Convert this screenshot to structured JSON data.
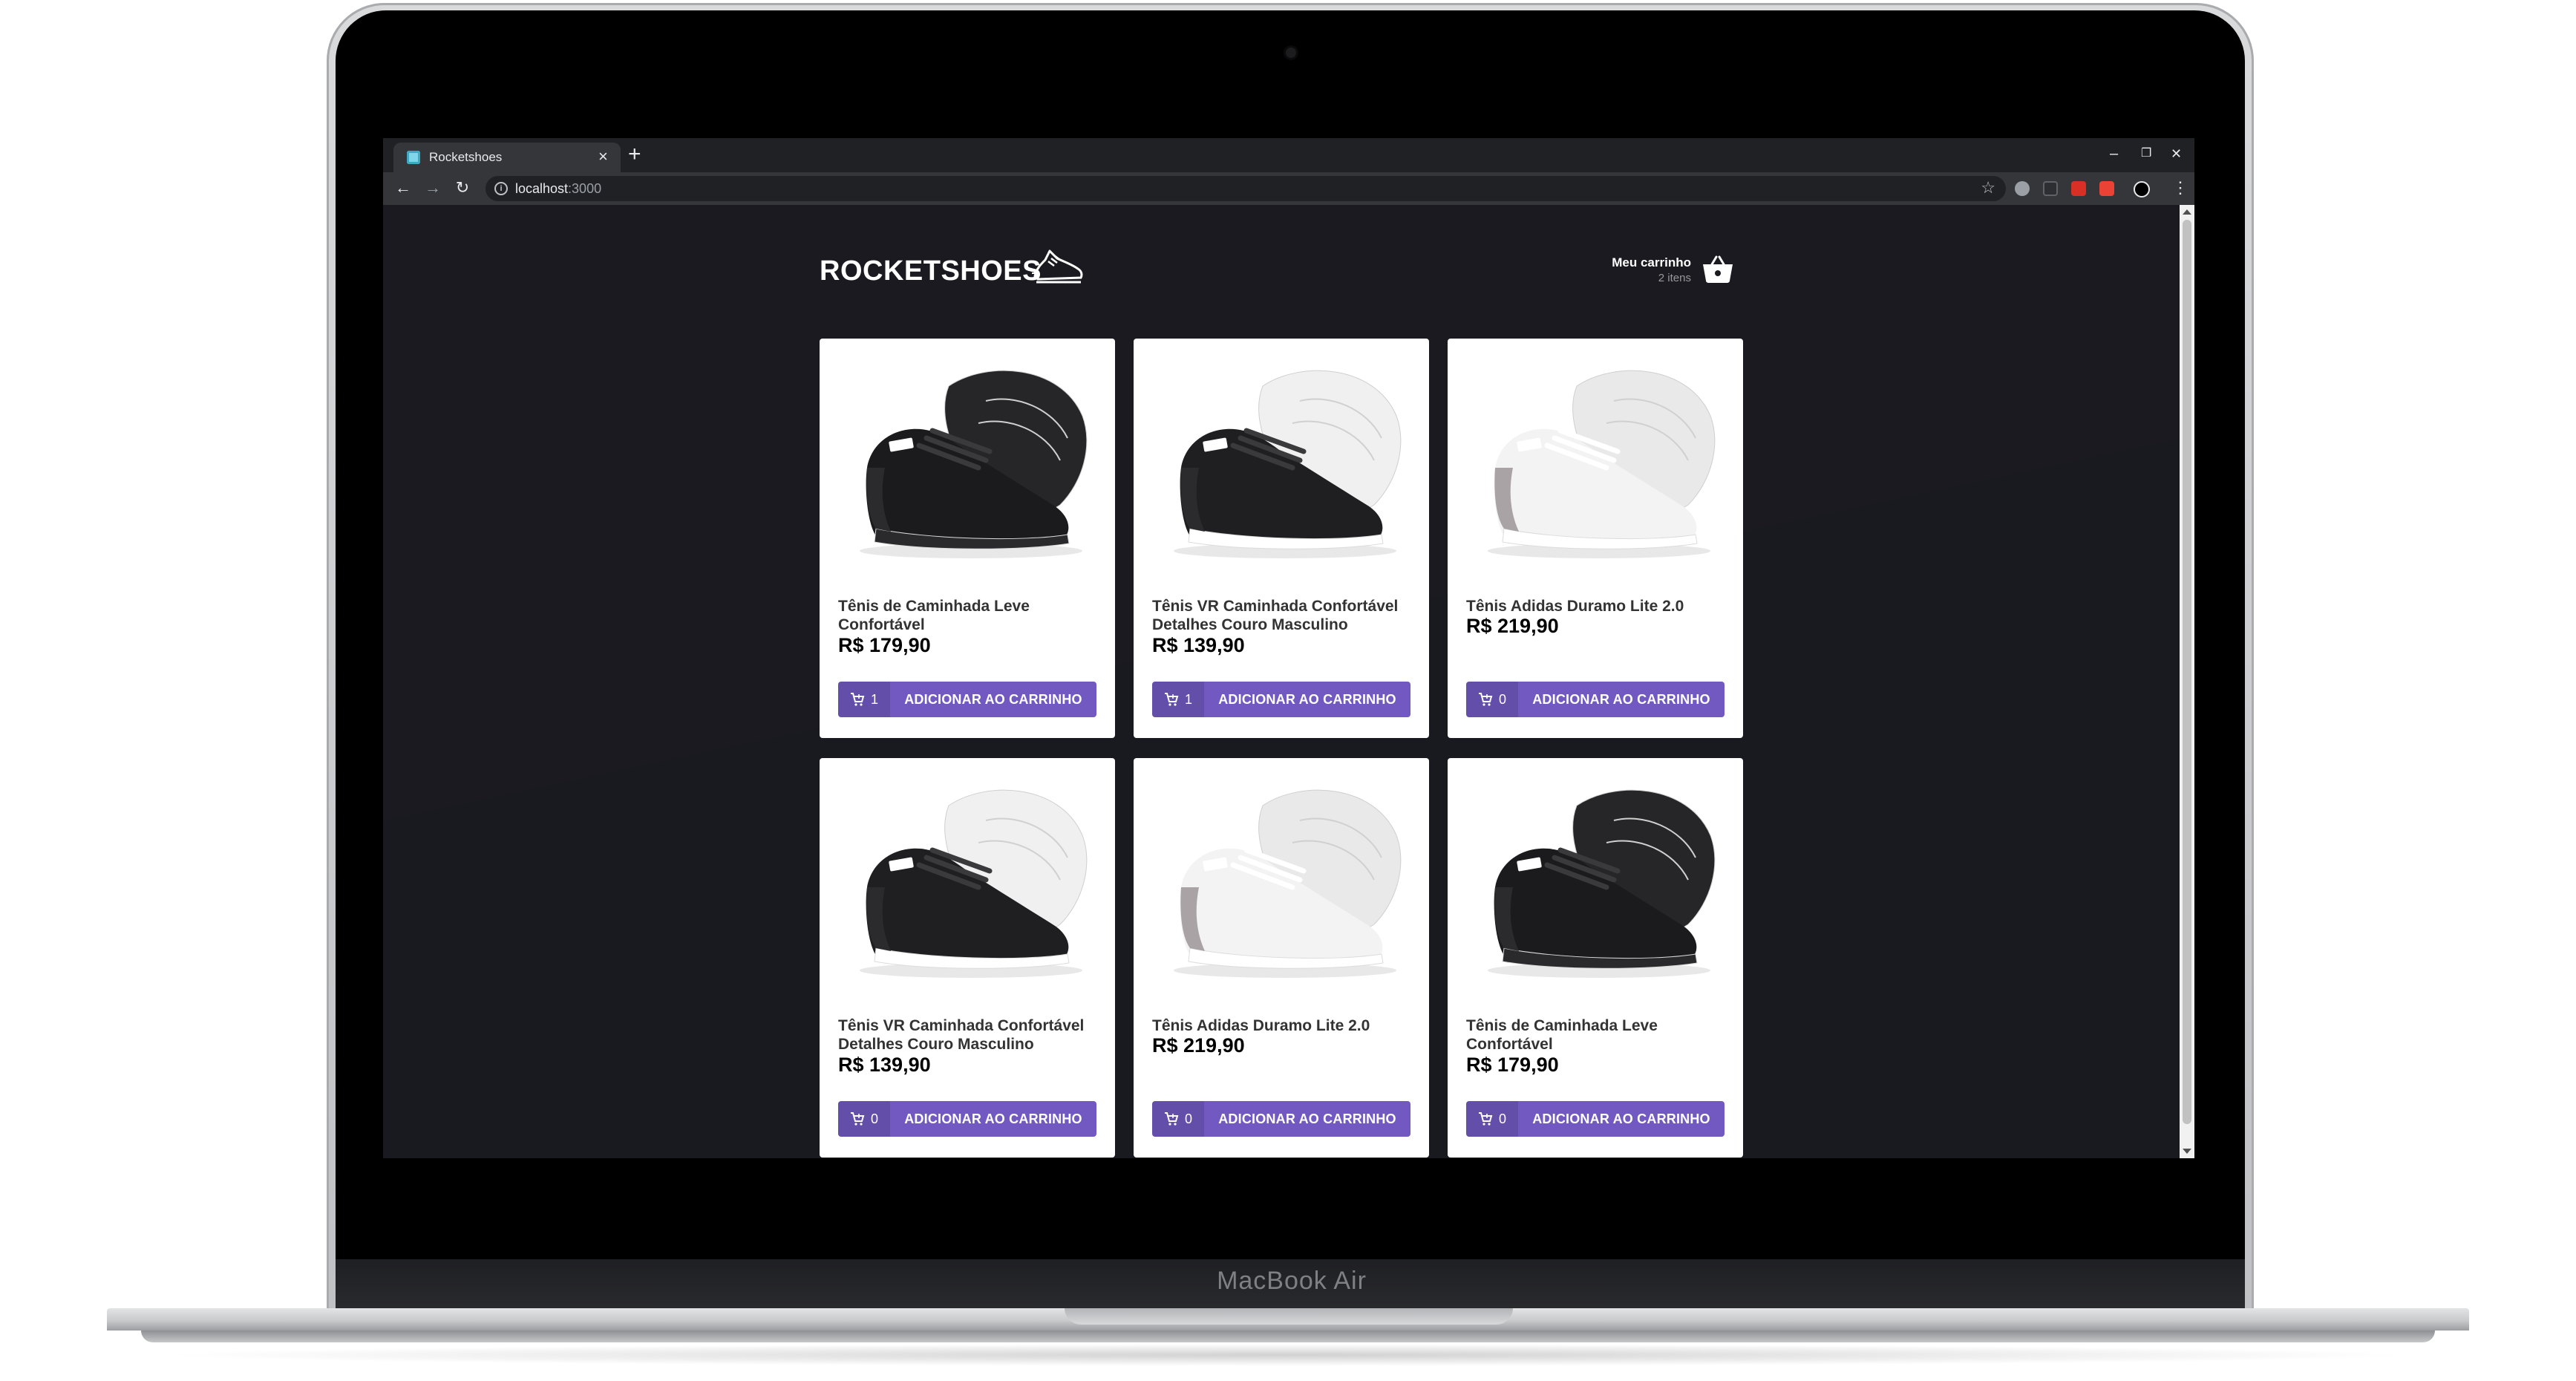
{
  "laptop": {
    "brand": "MacBook Air"
  },
  "browser": {
    "tab_title": "Rocketshoes",
    "tab_close": "×",
    "new_tab": "+",
    "window_controls": {
      "minimize": "–",
      "restore": "❐",
      "close": "✕"
    },
    "nav": {
      "back": "←",
      "forward": "→",
      "reload": "↻"
    },
    "url_host": "localhost",
    "url_port": ":3000",
    "menu": "⋮"
  },
  "header": {
    "logo": "ROCKETSHOES",
    "cart_title": "Meu carrinho",
    "cart_count": "2 itens"
  },
  "colors": {
    "accent": "#7159c1",
    "page_bg": "#191920"
  },
  "products": [
    {
      "title": "Tênis de Caminhada Leve Confortável",
      "price": "R$ 179,90",
      "cart_amount": "1",
      "button": "ADICIONAR AO CARRINHO",
      "shoe": "black"
    },
    {
      "title": "Tênis VR Caminhada Confortável Detalhes Couro Masculino",
      "price": "R$ 139,90",
      "cart_amount": "1",
      "button": "ADICIONAR AO CARRINHO",
      "shoe": "mixed"
    },
    {
      "title": "Tênis Adidas Duramo Lite 2.0",
      "price": "R$ 219,90",
      "cart_amount": "0",
      "button": "ADICIONAR AO CARRINHO",
      "shoe": "white"
    },
    {
      "title": "Tênis VR Caminhada Confortável Detalhes Couro Masculino",
      "price": "R$ 139,90",
      "cart_amount": "0",
      "button": "ADICIONAR AO CARRINHO",
      "shoe": "mixed"
    },
    {
      "title": "Tênis Adidas Duramo Lite 2.0",
      "price": "R$ 219,90",
      "cart_amount": "0",
      "button": "ADICIONAR AO CARRINHO",
      "shoe": "white"
    },
    {
      "title": "Tênis de Caminhada Leve Confortável",
      "price": "R$ 179,90",
      "cart_amount": "0",
      "button": "ADICIONAR AO CARRINHO",
      "shoe": "black"
    }
  ]
}
